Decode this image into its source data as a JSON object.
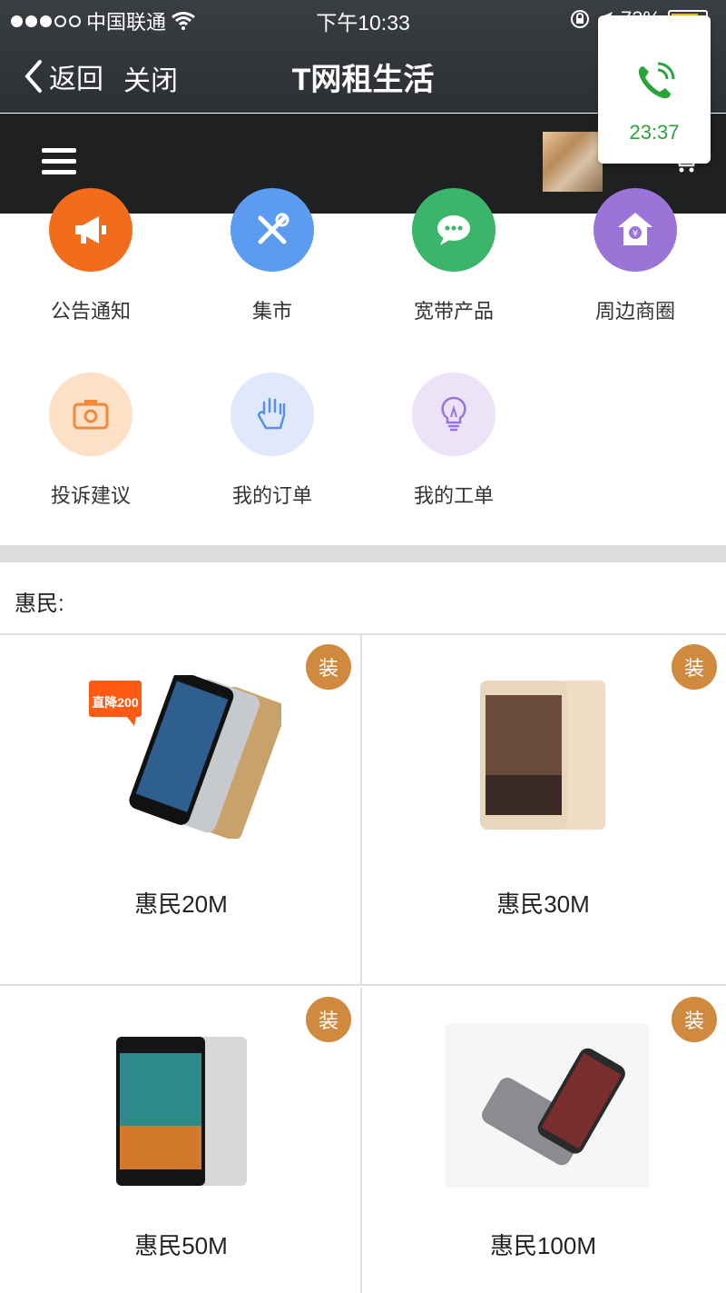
{
  "status_bar": {
    "carrier": "中国联通",
    "time": "下午10:33",
    "battery_percent": "73%"
  },
  "nav": {
    "back_label": "返回",
    "close_label": "关闭",
    "title": "T网租生活"
  },
  "call_popup": {
    "duration": "23:37"
  },
  "icon_grid": [
    {
      "label": "公告通知",
      "color": "#f26d1b",
      "icon": "megaphone-icon"
    },
    {
      "label": "集市",
      "color": "#5b9bf0",
      "icon": "tools-icon"
    },
    {
      "label": "宽带产品",
      "color": "#3ab56a",
      "icon": "chat-bubble-icon"
    },
    {
      "label": "周边商圈",
      "color": "#9b74d8",
      "icon": "shop-house-icon"
    },
    {
      "label": "投诉建议",
      "color": "#fde0c6",
      "icon": "camera-icon"
    },
    {
      "label": "我的订单",
      "color": "#dfe9fb",
      "icon": "hand-icon"
    },
    {
      "label": "我的工单",
      "color": "#ece3f8",
      "icon": "lightbulb-icon"
    }
  ],
  "section": {
    "title": "惠民:"
  },
  "products": [
    {
      "name": "惠民20M",
      "badge": "装",
      "promo": "直降200"
    },
    {
      "name": "惠民30M",
      "badge": "装"
    },
    {
      "name": "惠民50M",
      "badge": "装"
    },
    {
      "name": "惠民100M",
      "badge": "装"
    }
  ]
}
